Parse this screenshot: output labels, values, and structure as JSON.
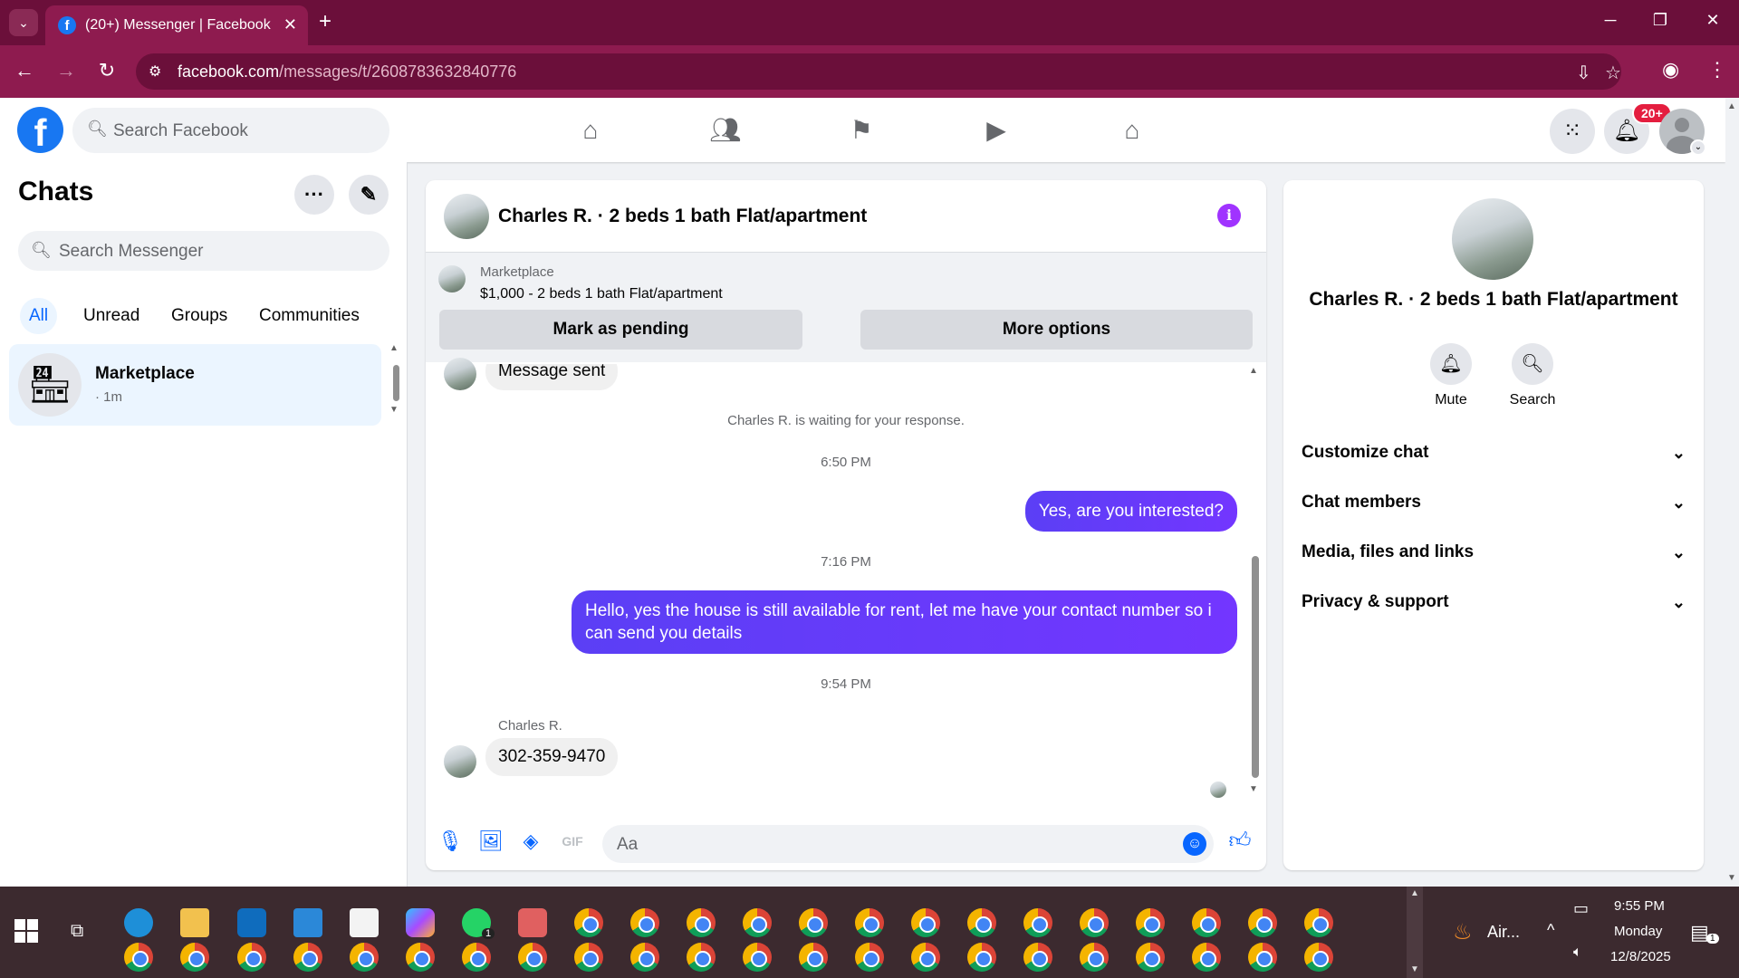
{
  "browser": {
    "tab_title": "(20+) Messenger | Facebook",
    "url_host": "facebook.com",
    "url_path": "/messages/t/2608783632840776"
  },
  "header": {
    "search_placeholder": "Search Facebook",
    "notification_badge": "20+",
    "nav_icons": [
      "home-icon",
      "friends-icon",
      "pages-flag-icon",
      "video-icon",
      "marketplace-icon"
    ]
  },
  "chats": {
    "title": "Chats",
    "search_placeholder": "Search Messenger",
    "filters": [
      "All",
      "Unread",
      "Groups",
      "Communities"
    ],
    "active_filter": "All",
    "conversations": [
      {
        "name": "Marketplace",
        "time": "· 1m"
      }
    ]
  },
  "conversation": {
    "title": "Charles R. · 2 beds 1 bath Flat/apartment",
    "marketplace": {
      "label": "Marketplace",
      "listing": "$1,000 - 2 beds 1 bath Flat/apartment",
      "pending_button": "Mark as pending",
      "options_button": "More options"
    },
    "messages": {
      "partial_message": "Message sent",
      "waiting_notice": "Charles R. is waiting for your response.",
      "time_1": "6:50 PM",
      "msg_out_1": "Yes, are you interested?",
      "time_2": "7:16 PM",
      "msg_out_2": "Hello, yes the house is still available for rent, let me have your contact number so i can send you details",
      "time_3": "9:54 PM",
      "sender": "Charles R.",
      "msg_in_1": "302-359-9470"
    },
    "composer_placeholder": "Aa"
  },
  "info_pane": {
    "name": "Charles R. · 2 beds 1 bath Flat/apartment",
    "actions": [
      "Mute",
      "Search"
    ],
    "sections": [
      "Customize chat",
      "Chat members",
      "Media, files and links",
      "Privacy & support"
    ]
  },
  "taskbar": {
    "weather": "Air...",
    "time": "9:55 PM",
    "day": "Monday",
    "date": "12/8/2025",
    "whatsapp_badge": "1",
    "notif_badge": "1"
  },
  "colors": {
    "chrome_frame": "#6b0f3a",
    "chrome_toolbar": "#8e1b4f",
    "facebook_blue": "#1877f2",
    "outgoing_bubble": "#6d36ff",
    "taskbar": "#3c2a2f"
  }
}
